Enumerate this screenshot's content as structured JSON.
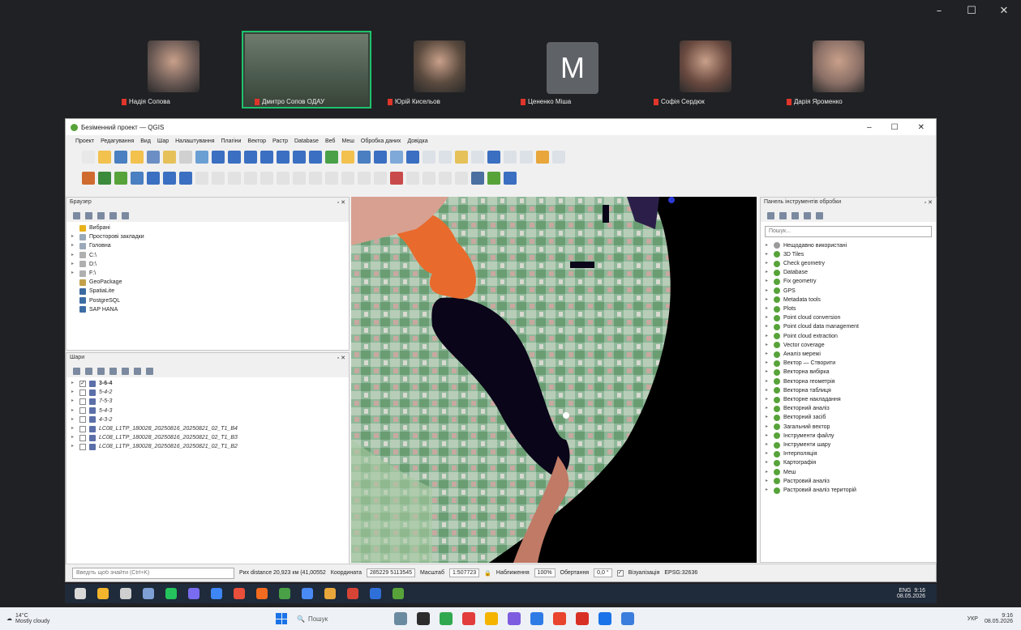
{
  "meet": {
    "controls": [
      "–",
      "☐",
      "✕"
    ],
    "participants": [
      {
        "name": "Надія Сопова",
        "type": "video",
        "color": "#6b5a55"
      },
      {
        "name": "Дмитро Сопов ОДАУ",
        "type": "video",
        "color": "#6e7b6d",
        "active": true
      },
      {
        "name": "Юрій Кисельов",
        "type": "video",
        "color": "#5a4a3e"
      },
      {
        "name": "Цененко Міша",
        "type": "initial",
        "initial": "M"
      },
      {
        "name": "Софія Сердюк",
        "type": "video",
        "color": "#6a4a40"
      },
      {
        "name": "Дарія Яроменко",
        "type": "video",
        "color": "#8a6f66"
      }
    ]
  },
  "qgis": {
    "title": "Безіменний проект — QGIS",
    "window_buttons": [
      "–",
      "☐",
      "✕"
    ],
    "menu": [
      "Проект",
      "Редагування",
      "Вид",
      "Шар",
      "Налаштування",
      "Плагіни",
      "Вектор",
      "Растр",
      "Database",
      "Веб",
      "Меш",
      "Обробка даних",
      "Довідка"
    ],
    "browser": {
      "title": "Браузер",
      "items": [
        {
          "label": "Вибрані",
          "icon": "star-icon",
          "color": "#e9b21b",
          "arrow": ""
        },
        {
          "label": "Просторові закладки",
          "icon": "bookmark-icon",
          "color": "#9aa9b9",
          "arrow": "▸"
        },
        {
          "label": "Головна",
          "icon": "home-folder-icon",
          "color": "#9aa9b9",
          "arrow": "▸"
        },
        {
          "label": "C:\\",
          "icon": "drive-icon",
          "color": "#b0b0b0",
          "arrow": "▸"
        },
        {
          "label": "D:\\",
          "icon": "drive-icon",
          "color": "#b0b0b0",
          "arrow": "▸"
        },
        {
          "label": "F:\\",
          "icon": "drive-icon",
          "color": "#b0b0b0",
          "arrow": "▸"
        },
        {
          "label": "GeoPackage",
          "icon": "geopackage-icon",
          "color": "#c3a14a",
          "arrow": ""
        },
        {
          "label": "SpatiaLite",
          "icon": "spatialite-icon",
          "color": "#3b6aa0",
          "arrow": ""
        },
        {
          "label": "PostgreSQL",
          "icon": "postgresql-icon",
          "color": "#3c6da5",
          "arrow": ""
        },
        {
          "label": "SAP HANA",
          "icon": "sap-hana-icon",
          "color": "#3c6da5",
          "arrow": ""
        }
      ]
    },
    "layers": {
      "title": "Шари",
      "items": [
        {
          "label": "3-6-4",
          "checked": true,
          "bold": true
        },
        {
          "label": "5-4-2",
          "checked": false
        },
        {
          "label": "7-5-3",
          "checked": false
        },
        {
          "label": "5-4-3",
          "checked": false
        },
        {
          "label": "4-3-2",
          "checked": false
        },
        {
          "label": "LC08_L1TP_180028_20250816_20250821_02_T1_B4",
          "checked": false
        },
        {
          "label": "LC08_L1TP_180028_20250816_20250821_02_T1_B3",
          "checked": false
        },
        {
          "label": "LC08_L1TP_180028_20250816_20250821_02_T1_B2",
          "checked": false
        }
      ]
    },
    "processing": {
      "title": "Панель інструментів обробки",
      "search_placeholder": "Пошук...",
      "items": [
        "Нещодавно використані",
        "3D Tiles",
        "Check geometry",
        "Database",
        "Fix geometry",
        "GPS",
        "Metadata tools",
        "Plots",
        "Point cloud conversion",
        "Point cloud data management",
        "Point cloud extraction",
        "Vector coverage",
        "Аналіз мережі",
        "Вектор — Створити",
        "Векторна вибірка",
        "Векторна геометрія",
        "Векторна таблиця",
        "Векторне накладання",
        "Векторний аналіз",
        "Векторний засіб",
        "Загальний вектор",
        "Інструменти файлу",
        "Інструменти шару",
        "Інтерполяція",
        "Картографія",
        "Меш",
        "Растровий аналіз",
        "Растровий аналіз територій"
      ]
    },
    "status": {
      "locator_placeholder": "Введіть щоб знайти (Ctrl+K)",
      "distance": "Рих distance 20,923 км (41,00552",
      "coord_label": "Координата",
      "coord_value": "285229  5113545",
      "scale_label": "Масштаб",
      "scale_value": "1:507723",
      "magnifier_label": "Наближення",
      "magnifier_value": "100%",
      "rotation_label": "Обертання",
      "rotation_value": "0,0 °",
      "render_label": "Візуалізація",
      "crs": "EPSG:32636"
    }
  },
  "inner_taskbar": {
    "time": "9:16",
    "date": "08.05.2026",
    "lang": "ENG",
    "icon_colors": [
      "#d9d9d9",
      "#f2b52b",
      "#cfcfcf",
      "#7ea0d5",
      "#24c35d",
      "#7a6cf0",
      "#3e86f5",
      "#e94f3a",
      "#f36b20",
      "#49a047",
      "#4a8af4",
      "#e8a63b",
      "#d64436",
      "#2f6fd8",
      "#57a33a"
    ]
  },
  "outer_taskbar": {
    "weather_temp": "14°C",
    "weather_desc": "Mostly cloudy",
    "search_label": "Пошук",
    "lang": "УКР",
    "time": "9:16",
    "date": "08.05.2026",
    "icon_colors": [
      "#6a8aa0",
      "#2d2d2d",
      "#30a84f",
      "#e23c3c",
      "#f4b400",
      "#7d5cdf",
      "#2e7be6",
      "#e8442e",
      "#d93025",
      "#1a73e8",
      "#3b7ddd"
    ]
  }
}
